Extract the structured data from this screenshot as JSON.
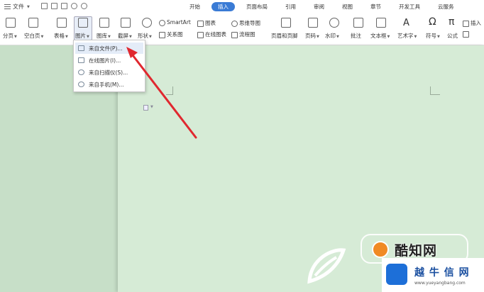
{
  "topbar": {
    "file_label": "文件",
    "tabs": [
      {
        "label": "开始"
      },
      {
        "label": "插入"
      },
      {
        "label": "页面布局"
      },
      {
        "label": "引用"
      },
      {
        "label": "审阅"
      },
      {
        "label": "视图"
      },
      {
        "label": "章节"
      },
      {
        "label": "开发工具"
      },
      {
        "label": "云服务"
      }
    ],
    "active_tab": "插入"
  },
  "ribbon": {
    "page_break": "分页",
    "blank_page": "空白页",
    "table": "表格",
    "picture": "图片",
    "gallery": "图库",
    "screenshot": "截屏",
    "shape": "形状",
    "smartart": "SmartArt",
    "relation": "关系图",
    "chart": "图表",
    "online_chart": "在线图表",
    "mindmap": "思维导图",
    "flowchart": "流程图",
    "header_footer": "页眉和页脚",
    "page_number": "页码",
    "watermark": "水印",
    "comment": "批注",
    "textbox": "文本框",
    "wordart": "艺术字",
    "symbol": "符号",
    "formula": "公式",
    "insert": "插入"
  },
  "picture_menu": {
    "items": [
      {
        "label": "来自文件(P)..."
      },
      {
        "label": "在线图片(I)..."
      },
      {
        "label": "来自扫描仪(S)..."
      },
      {
        "label": "来自手机(M)..."
      }
    ]
  },
  "watermark_logo": {
    "brand1": "酷知网",
    "brand2": "越 牛 信 网",
    "url": "www.yueyangbang.com"
  },
  "colors": {
    "accent": "#3a7bd5",
    "page_bg": "#d6ebd6",
    "arrow": "#e0282f"
  }
}
